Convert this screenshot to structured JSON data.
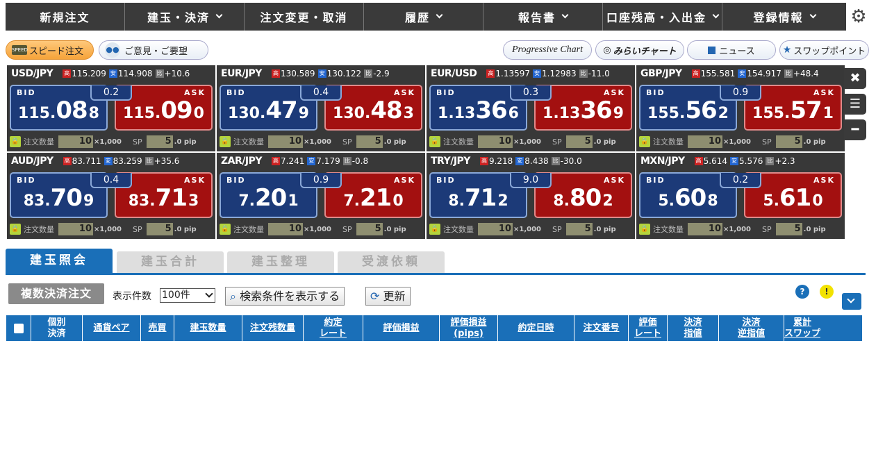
{
  "nav": {
    "items": [
      {
        "label": "新規注文",
        "dropdown": false
      },
      {
        "label": "建玉・決済",
        "dropdown": true
      },
      {
        "label": "注文変更・取消",
        "dropdown": false
      },
      {
        "label": "履歴",
        "dropdown": true
      },
      {
        "label": "報告書",
        "dropdown": true
      },
      {
        "label": "口座残高・入出金",
        "dropdown": true
      },
      {
        "label": "登録情報",
        "dropdown": true
      }
    ]
  },
  "toolbar": {
    "speed_order": "スピード注文",
    "speed_icon_text": "SPEED",
    "feedback": "ご意見・ご要望",
    "progressive_chart": "Progressive Chart",
    "mirai_chart": "みらいチャート",
    "news": "ニュース",
    "swap_points": "スワップポイント"
  },
  "labels": {
    "bid": "BID",
    "ask": "ASK",
    "high_icon": "高",
    "low_icon": "安",
    "change_icon": "比",
    "order_qty": "注文数量",
    "unit": "×1,000",
    "sp": "SP",
    "pip": ".0 pip"
  },
  "rates": [
    {
      "pair": "USD/JPY",
      "high": "115.209",
      "low": "114.908",
      "change": "+10.6",
      "spread": "0.2",
      "bid": {
        "small": "115.",
        "big": "08",
        "last": "8"
      },
      "ask": {
        "small": "115.",
        "big": "09",
        "last": "0"
      },
      "qty": "10",
      "sp": "5"
    },
    {
      "pair": "EUR/JPY",
      "high": "130.589",
      "low": "130.122",
      "change": "-2.9",
      "spread": "0.4",
      "bid": {
        "small": "130.",
        "big": "47",
        "last": "9"
      },
      "ask": {
        "small": "130.",
        "big": "48",
        "last": "3"
      },
      "qty": "10",
      "sp": "5"
    },
    {
      "pair": "EUR/USD",
      "high": "1.13597",
      "low": "1.12983",
      "change": "-11.0",
      "spread": "0.3",
      "bid": {
        "small": "1.13",
        "big": "36",
        "last": "6"
      },
      "ask": {
        "small": "1.13",
        "big": "36",
        "last": "9"
      },
      "qty": "10",
      "sp": "5"
    },
    {
      "pair": "GBP/JPY",
      "high": "155.581",
      "low": "154.917",
      "change": "+48.4",
      "spread": "0.9",
      "bid": {
        "small": "155.",
        "big": "56",
        "last": "2"
      },
      "ask": {
        "small": "155.",
        "big": "57",
        "last": "1"
      },
      "qty": "10",
      "sp": "5"
    },
    {
      "pair": "AUD/JPY",
      "high": "83.711",
      "low": "83.259",
      "change": "+35.6",
      "spread": "0.4",
      "bid": {
        "small": "83.",
        "big": "70",
        "last": "9"
      },
      "ask": {
        "small": "83.",
        "big": "71",
        "last": "3"
      },
      "qty": "10",
      "sp": "5"
    },
    {
      "pair": "ZAR/JPY",
      "high": "7.241",
      "low": "7.179",
      "change": "-0.8",
      "spread": "0.9",
      "bid": {
        "small": "7.",
        "big": "20",
        "last": "1"
      },
      "ask": {
        "small": "7.",
        "big": "21",
        "last": "0"
      },
      "qty": "10",
      "sp": "5"
    },
    {
      "pair": "TRY/JPY",
      "high": "9.218",
      "low": "8.438",
      "change": "-30.0",
      "spread": "9.0",
      "bid": {
        "small": "8.",
        "big": "71",
        "last": "2"
      },
      "ask": {
        "small": "8.",
        "big": "80",
        "last": "2"
      },
      "qty": "10",
      "sp": "5"
    },
    {
      "pair": "MXN/JPY",
      "high": "5.614",
      "low": "5.576",
      "change": "+2.3",
      "spread": "0.2",
      "bid": {
        "small": "5.",
        "big": "60",
        "last": "8"
      },
      "ask": {
        "small": "5.",
        "big": "61",
        "last": "0"
      },
      "qty": "10",
      "sp": "5"
    }
  ],
  "tabs": [
    "建玉照会",
    "建玉合計",
    "建玉整理",
    "受渡依頼"
  ],
  "positions_toolbar": {
    "multi_settle": "複数決済注文",
    "count_label": "表示件数",
    "count_value": "100件",
    "search_toggle": "検索条件を表示する",
    "refresh": "更新",
    "help_icon": "?",
    "alert_icon": "!"
  },
  "table_headers": [
    "個別\n決済",
    "通貨ペア",
    "売買",
    "建玉数量",
    "注文残数量",
    "約定\nレート",
    "評価損益",
    "評価損益\n(pips)",
    "約定日時",
    "注文番号",
    "評価\nレート",
    "決済\n指値",
    "決済\n逆指値",
    "累計\nスワップ"
  ],
  "colors": {
    "nav_bg": "#3a3a3a",
    "bid_bg": "#1c3a78",
    "ask_bg": "#a31010",
    "tab_active": "#1a6fb8",
    "table_header": "#1a6fb8"
  }
}
